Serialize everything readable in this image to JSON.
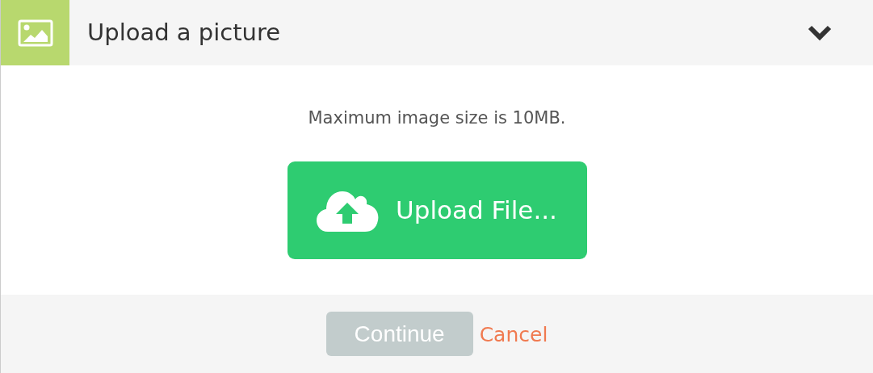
{
  "header": {
    "title": "Upload a picture"
  },
  "body": {
    "note": "Maximum image size is 10MB.",
    "upload_button": "Upload File..."
  },
  "footer": {
    "continue": {
      "label": "Continue",
      "disabled": true
    },
    "cancel": "Cancel"
  }
}
